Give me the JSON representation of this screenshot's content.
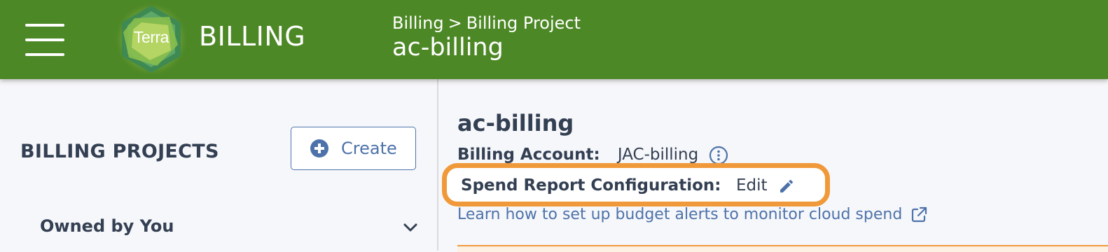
{
  "header": {
    "logo_text": "Terra",
    "app_title": "BILLING",
    "breadcrumb": [
      "Billing",
      "Billing Project"
    ],
    "breadcrumb_separator": ">",
    "page_name": "ac-billing",
    "bar_color": "#4d8826"
  },
  "sidebar": {
    "section_title": "BILLING PROJECTS",
    "create_label": "Create",
    "owned_section_label": "Owned by You",
    "owned_section_icon": "chevron-down-icon"
  },
  "main": {
    "project_title": "ac-billing",
    "billing_account_label": "Billing Account:",
    "billing_account_value": "JAC-billing",
    "billing_account_icon": "info-icon",
    "spend_report_label": "Spend Report Configuration:",
    "edit_label": "Edit",
    "edit_icon": "pencil-icon",
    "learn_link": "Learn how to set up budget alerts to monitor cloud spend",
    "learn_link_icon": "external-link-icon"
  },
  "colors": {
    "accent_blue": "#4d72aa",
    "highlight_orange": "#f0993a",
    "text_dark": "#333f52"
  }
}
